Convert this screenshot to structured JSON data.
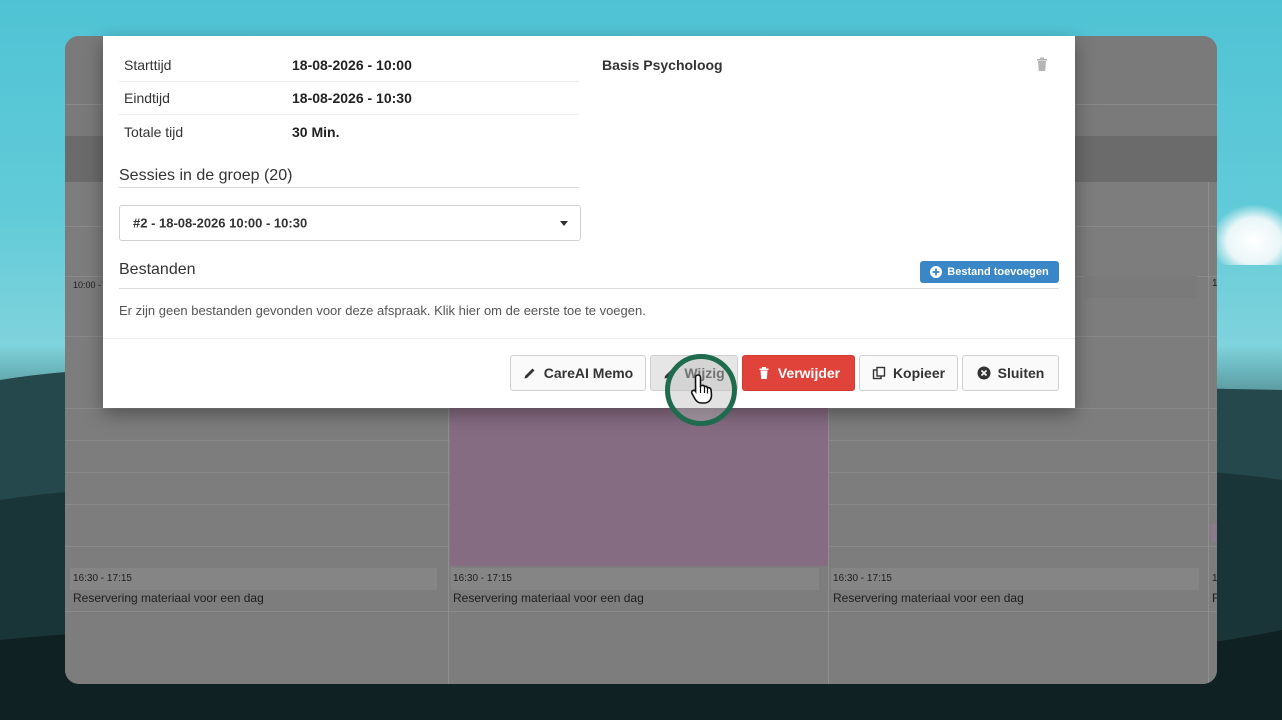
{
  "details": {
    "start_label": "Starttijd",
    "start_value": "18-08-2026 - 10:00",
    "end_label": "Eindtijd",
    "end_value": "18-08-2026 - 10:30",
    "total_label": "Totale tijd",
    "total_value": "30 Min.",
    "provider": "Basis Psycholoog"
  },
  "sessions": {
    "title": "Sessies in de groep (20)",
    "selected": "#2 - 18-08-2026 10:00 - 10:30"
  },
  "files": {
    "title": "Bestanden",
    "add_label": "Bestand toevoegen",
    "empty_text": "Er zijn geen bestanden gevonden voor deze afspraak. Klik hier om de eerste toe te voegen."
  },
  "footer": {
    "memo_label": "CareAI Memo",
    "edit_label": "Wijzig",
    "delete_label": "Verwijder",
    "copy_label": "Kopieer",
    "close_label": "Sluiten"
  },
  "calendar": {
    "side_time": "10:00 -",
    "slots": [
      {
        "time": "16:30 - 17:15",
        "title": "Reservering materiaal voor een dag"
      },
      {
        "time": "16:30 - 17:15",
        "title": "Reservering materiaal voor een dag"
      },
      {
        "time": "16:30 - 17:15",
        "title": "Reservering materiaal voor een dag"
      }
    ],
    "right_edge_marks": [
      "1",
      "1",
      "F"
    ]
  },
  "colors": {
    "delete_button": "#e0433a",
    "add_file_button": "#3a87c8",
    "cursor_ring": "#1f6b4d",
    "purple_event": "#866c83"
  }
}
